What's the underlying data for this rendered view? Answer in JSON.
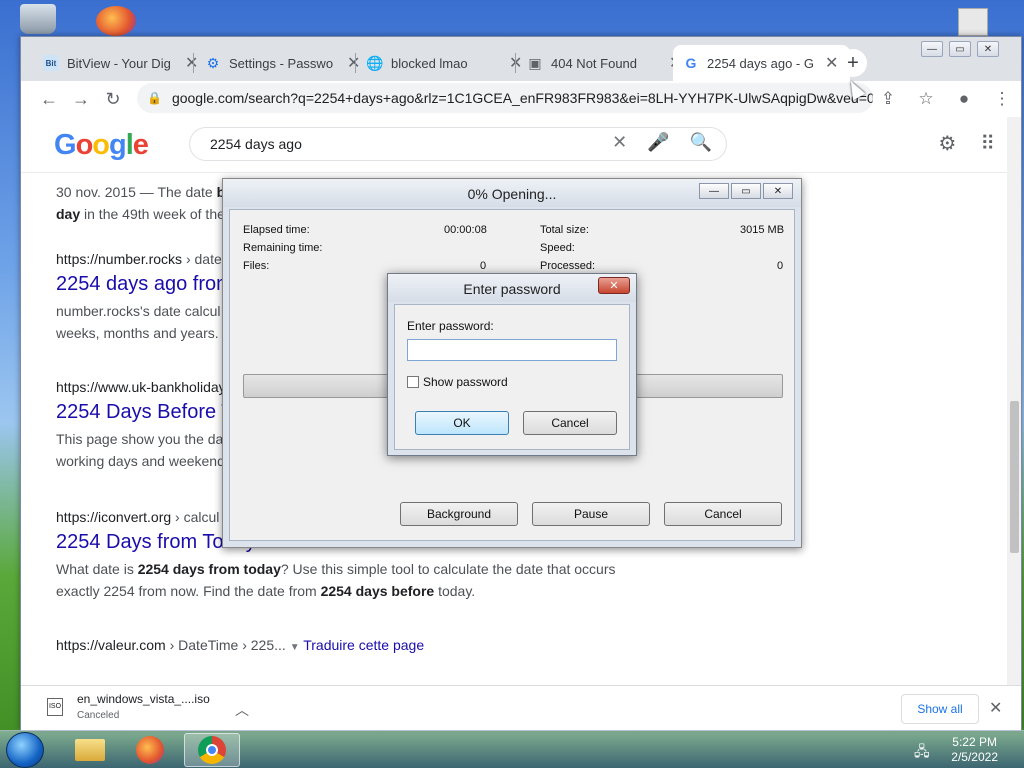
{
  "tabs": [
    {
      "label": "BitView - Your Dig",
      "icon": "bitview-icon"
    },
    {
      "label": "Settings - Passwo",
      "icon": "gear-icon"
    },
    {
      "label": "blocked lmao",
      "icon": "globe-icon"
    },
    {
      "label": "404 Not Found",
      "icon": "file-icon"
    },
    {
      "label": "2254 days ago - G",
      "icon": "google-icon"
    }
  ],
  "address": "google.com/search?q=2254+days+ago&rlz=1C1GCEA_enFR983FR983&ei=8LH-YYH7PK-UlwSAqpigDw&ved=0...",
  "google": {
    "logo": "Google",
    "query": "2254 days ago"
  },
  "results": [
    {
      "snippet_pre": "30 nov. 2015 — The date ",
      "snippet_bold": "b",
      "snippet_line2_bold": "day",
      "snippet_line2": " in the 49th week of the"
    },
    {
      "url": "https://number.rocks",
      "crumb": " › date",
      "title": "2254 days ago from",
      "snippet1": "number.rocks's date calcul",
      "snippet2": "weeks, months and years."
    },
    {
      "url": "https://www.uk-bankholiday",
      "title": "2254 Days Before T",
      "snippet1": "This page show you the da",
      "snippet2": "working days and weekend"
    },
    {
      "url": "https://iconvert.org",
      "crumb": " › calcul",
      "title": "2254 Days from Today - iConvert",
      "s1a": "What date is ",
      "s1b": "2254 days from today",
      "s1c": "? Use this simple tool to calculate the date that occurs",
      "s2a": "exactly 2254 from now. Find the date from ",
      "s2b": "2254 days before",
      "s2c": " today."
    },
    {
      "url": "https://valeur.com",
      "crumb": " › DateTime › 225...",
      "translate": "Traduire cette page"
    }
  ],
  "opening": {
    "title": "0% Opening...",
    "elapsed_label": "Elapsed time:",
    "elapsed_value": "00:00:08",
    "remaining_label": "Remaining time:",
    "files_label": "Files:",
    "files_value": "0",
    "total_label": "Total size:",
    "total_value": "3015 MB",
    "speed_label": "Speed:",
    "processed_label": "Processed:",
    "processed_value": "0",
    "progress": 0,
    "buttons": {
      "background": "Background",
      "pause": "Pause",
      "cancel": "Cancel"
    }
  },
  "password": {
    "title": "Enter password",
    "label": "Enter password:",
    "value": "",
    "show_label": "Show password",
    "show_checked": false,
    "ok": "OK",
    "cancel": "Cancel"
  },
  "download": {
    "filename": "en_windows_vista_....iso",
    "status": "Canceled",
    "show_all": "Show all"
  },
  "taskbar": {
    "time": "5:22 PM",
    "date": "2/5/2022"
  }
}
